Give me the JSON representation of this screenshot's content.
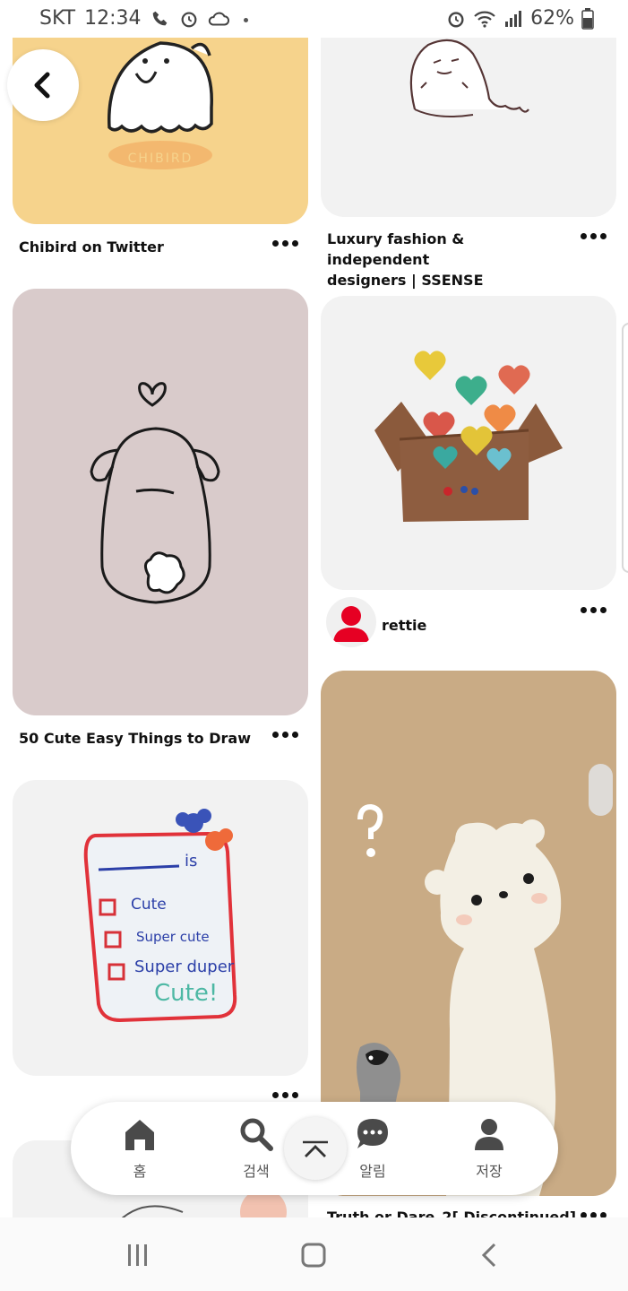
{
  "status_bar": {
    "carrier": "SKT",
    "time": "12:34",
    "battery": "62%"
  },
  "pins": [
    {
      "title": "Chibird on Twitter",
      "image_text": "CHIBIRD"
    },
    {
      "title_line1": "Luxury fashion & independent",
      "title_line2": "designers | SSENSE"
    },
    {
      "user": "rettie"
    },
    {
      "title": "50 Cute Easy Things to Draw"
    },
    {
      "list_lines": [
        "_______ is",
        "Cute",
        "Super cute",
        "Super duper",
        "Cute!"
      ]
    },
    {
      "title": "Truth or Dare_2[ Discontinued]"
    }
  ],
  "bottom_nav": {
    "items": [
      {
        "label": "홈",
        "icon": "home-icon"
      },
      {
        "label": "검색",
        "icon": "search-icon"
      },
      {
        "label": "알림",
        "icon": "chat-bubble-icon"
      },
      {
        "label": "저장",
        "icon": "person-icon"
      }
    ],
    "scroll_top_icon": "chevron-up-icon"
  },
  "colors": {
    "chibird_bg": "#f6d38c",
    "bunny_bg": "#d9cbcb",
    "bear_bg": "#c9ab85",
    "card_light": "#f2f2f2",
    "avatar_red": "#e60023"
  }
}
